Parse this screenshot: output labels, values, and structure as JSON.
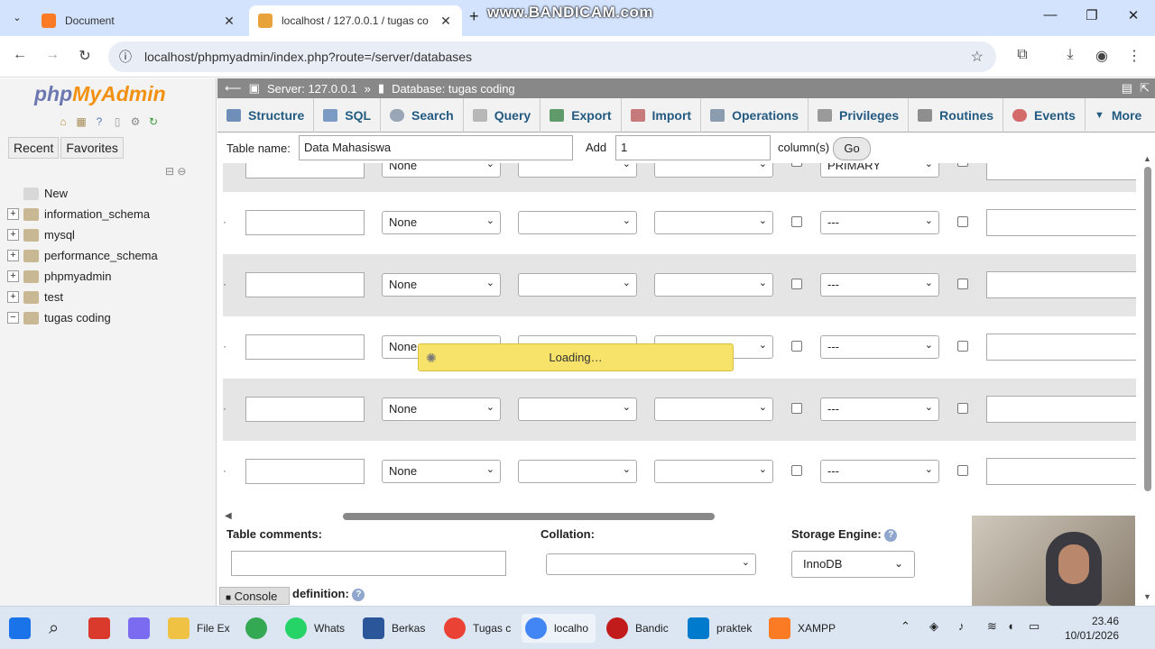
{
  "browser": {
    "tabs": [
      {
        "title": "Document",
        "active": false
      },
      {
        "title": "localhost / 127.0.0.1 / tugas co",
        "active": true
      }
    ],
    "url": "localhost/phpmyadmin/index.php?route=/server/databases",
    "watermark": "www.BANDICAM.com"
  },
  "sidebar": {
    "logo_php": "php",
    "logo_myadmin": "MyAdmin",
    "tabs": [
      "Recent",
      "Favorites"
    ],
    "tree": [
      {
        "label": "New",
        "expandable": false
      },
      {
        "label": "information_schema",
        "expandable": true
      },
      {
        "label": "mysql",
        "expandable": true
      },
      {
        "label": "performance_schema",
        "expandable": true
      },
      {
        "label": "phpmyadmin",
        "expandable": true
      },
      {
        "label": "test",
        "expandable": true
      },
      {
        "label": "tugas coding",
        "expandable": true,
        "expanded": true
      }
    ]
  },
  "breadcrumb": {
    "server": "Server: 127.0.0.1",
    "separator": "»",
    "database": "Database: tugas coding"
  },
  "menu": [
    "Structure",
    "SQL",
    "Search",
    "Query",
    "Export",
    "Import",
    "Operations",
    "Privileges",
    "Routines",
    "Events",
    "More"
  ],
  "form": {
    "table_name_label": "Table name:",
    "table_name_value": "Data Mahasiswa",
    "add_label": "Add",
    "add_value": "1",
    "columns_label": "column(s)",
    "go_label": "Go"
  },
  "grid": {
    "type_value": "None",
    "index_value": "---",
    "partial_top": {
      "type": "None",
      "index": "PRIMARY"
    },
    "row_count": 5
  },
  "loading_text": "Loading…",
  "bottom": {
    "table_comments_label": "Table comments:",
    "collation_label": "Collation:",
    "storage_engine_label": "Storage Engine:",
    "storage_engine_value": "InnoDB",
    "definition_label": "definition:",
    "console_label": "Console"
  },
  "taskbar": {
    "apps": [
      "File Ex",
      "Whats",
      "Berkas",
      "Tugas c",
      "localho",
      "Bandic",
      "praktek",
      "XAMPP"
    ],
    "time": "23.46",
    "date": "10/01/2026"
  },
  "colors": {
    "pma_link": "#235a81",
    "loading_bg": "#f7e26a",
    "breadcrumb_bg": "#888888",
    "tabstrip_bg": "#d3e3fd"
  }
}
